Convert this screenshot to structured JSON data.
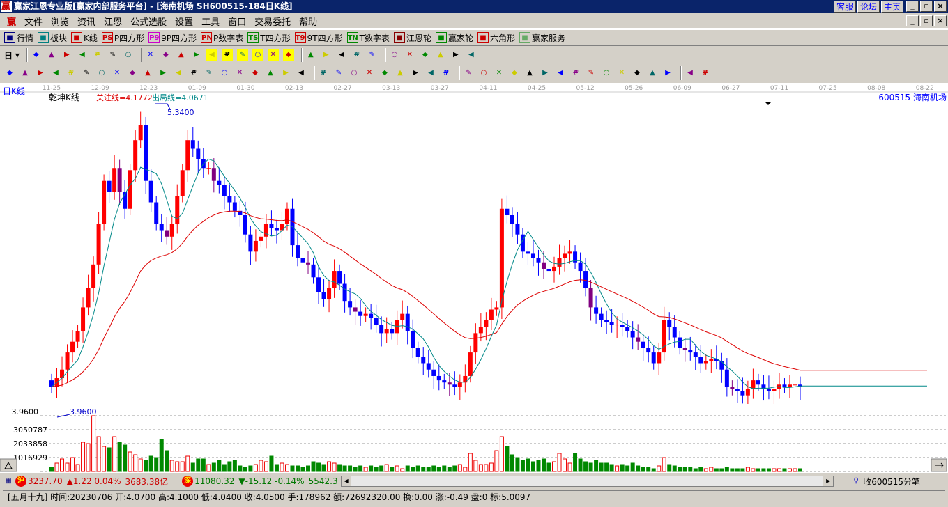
{
  "window": {
    "title": "赢家江恩专业版[赢家内部服务平台] - [海南机场   SH600515-184日K线]",
    "links": [
      "客服",
      "论坛",
      "主页"
    ],
    "controls": [
      "_",
      "▫",
      "×"
    ]
  },
  "menu": [
    "文件",
    "浏览",
    "资讯",
    "江恩",
    "公式选股",
    "设置",
    "工具",
    "窗口",
    "交易委托",
    "帮助"
  ],
  "toolbar1": [
    {
      "icon": "table-icon",
      "label": "行情"
    },
    {
      "icon": "blocks-icon",
      "label": "板块"
    },
    {
      "icon": "kline-icon",
      "label": "K线"
    },
    {
      "icon": "PS",
      "label": "P四方形"
    },
    {
      "icon": "P9",
      "label": "9P四方形"
    },
    {
      "icon": "PN",
      "label": "P数字表"
    },
    {
      "icon": "TS",
      "label": "T四方形"
    },
    {
      "icon": "T9",
      "label": "9T四方形"
    },
    {
      "icon": "TN",
      "label": "T数字表"
    },
    {
      "icon": "wheel-icon",
      "label": "江恩轮"
    },
    {
      "icon": "wheel-icon",
      "label": "赢家轮"
    },
    {
      "icon": "hexagon-icon",
      "label": "六角形"
    },
    {
      "icon": "dollar-icon",
      "label": "赢家服务"
    }
  ],
  "toolbar2": {
    "period": "日",
    "icons": [
      "zoom",
      "list",
      "k3",
      "k9",
      "candle",
      "cut",
      "flag",
      "first",
      "last",
      "left",
      "right",
      "d1",
      "d2",
      "d3",
      "d4",
      "d5",
      "d6",
      "hand",
      "cross",
      "line",
      "gate",
      "wave",
      "cal",
      "calc",
      "book",
      "save",
      "print",
      "monitor"
    ]
  },
  "toolbar3": {
    "icons": [
      "pen",
      "ii",
      "gold1",
      "gold2",
      "f",
      "spiral",
      "pen2",
      "circle",
      "iii",
      "n2",
      "angle",
      "target",
      "star",
      "box",
      "slash",
      "shen",
      "ying",
      "comb",
      "measure",
      "frame",
      "fan1",
      "fan2",
      "fan3",
      "angle2",
      "v",
      "grid1",
      "grid2",
      "lines",
      "bars",
      "pct1",
      "%",
      "pct2",
      "gold3",
      "gold4",
      "up",
      "ab",
      "gold5",
      "j",
      "f2",
      "gold6",
      "shen2",
      "ying2",
      "four",
      "yinyang",
      "infinity"
    ]
  },
  "chart": {
    "period_label": "日K线",
    "indicator": "乾坤K线",
    "focus_line": "关注线=4.1772",
    "exit_line": "出局线=4.0671",
    "stock": "600515 海南机场",
    "high_label": "5.3400",
    "low_label": "3.9600",
    "price_axis": "3.9600",
    "dates": [
      "11-25",
      "12-09",
      "12-23",
      "01-09",
      "01-30",
      "02-13",
      "02-27",
      "03-13",
      "03-27",
      "04-11",
      "04-25",
      "05-12",
      "05-26",
      "06-09",
      "06-27",
      "07-11",
      "07-25",
      "08-08",
      "08-22"
    ],
    "vol_ticks": [
      "3050787",
      "2033858",
      "1016929"
    ]
  },
  "chart_data": {
    "type": "candlestick",
    "price_range": [
      3.96,
      5.34
    ],
    "close": [
      4.04,
      4.08,
      4.12,
      4.2,
      4.25,
      4.3,
      4.41,
      4.5,
      4.61,
      4.8,
      5.0,
      4.95,
      5.06,
      4.95,
      4.87,
      5.05,
      5.19,
      5.26,
      5.0,
      4.9,
      4.8,
      4.77,
      4.74,
      4.8,
      4.93,
      5.05,
      5.19,
      5.15,
      5.1,
      5.06,
      5.06,
      5.0,
      4.98,
      4.93,
      4.9,
      4.86,
      4.84,
      4.75,
      4.67,
      4.72,
      4.74,
      4.8,
      4.78,
      4.77,
      4.8,
      4.87,
      4.7,
      4.64,
      4.62,
      4.61,
      4.55,
      4.48,
      4.45,
      4.5,
      4.58,
      4.52,
      4.44,
      4.41,
      4.39,
      4.37,
      4.38,
      4.36,
      4.33,
      4.29,
      4.31,
      4.29,
      4.35,
      4.38,
      4.3,
      4.22,
      4.18,
      4.15,
      4.12,
      4.09,
      4.07,
      4.06,
      4.05,
      4.04,
      4.06,
      4.09,
      4.2,
      4.29,
      4.32,
      4.35,
      4.4,
      4.41,
      4.87,
      4.84,
      4.8,
      4.75,
      4.67,
      4.66,
      4.64,
      4.62,
      4.59,
      4.58,
      4.6,
      4.64,
      4.66,
      4.67,
      4.62,
      4.58,
      4.5,
      4.41,
      4.38,
      4.35,
      4.34,
      4.33,
      4.33,
      4.32,
      4.3,
      4.27,
      4.25,
      4.22,
      4.2,
      4.15,
      4.2,
      4.35,
      4.32,
      4.27,
      4.22,
      4.21,
      4.2,
      4.18,
      4.15,
      4.16,
      4.17,
      4.16,
      4.12,
      4.04,
      4.03,
      4.02,
      4.0,
      4.03,
      4.07,
      4.05,
      4.03,
      4.02,
      4.03,
      4.05,
      4.04,
      4.05,
      4.05,
      4.04
    ],
    "volume_millions": [
      0.3,
      0.6,
      0.9,
      0.6,
      1.0,
      0.5,
      2.1,
      2.0,
      4.0,
      2.5,
      1.8,
      1.7,
      2.5,
      2.1,
      1.9,
      1.4,
      1.2,
      0.9,
      0.8,
      1.1,
      1.0,
      2.3,
      1.5,
      0.8,
      0.7,
      0.7,
      1.1,
      0.6,
      0.9,
      0.9,
      0.5,
      0.6,
      0.8,
      0.5,
      0.7,
      0.8,
      0.4,
      0.3,
      0.4,
      0.5,
      0.8,
      0.7,
      1.1,
      0.5,
      0.6,
      0.5,
      0.4,
      0.4,
      0.3,
      0.4,
      0.7,
      0.6,
      0.5,
      0.7,
      0.6,
      0.5,
      0.4,
      0.4,
      0.3,
      0.4,
      0.3,
      0.4,
      0.3,
      0.4,
      0.5,
      0.3,
      0.4,
      0.2,
      0.4,
      0.3,
      0.4,
      0.3,
      0.3,
      0.4,
      0.3,
      0.4,
      0.3,
      0.4,
      0.5,
      0.3,
      1.3,
      0.8,
      0.5,
      0.5,
      0.6,
      1.5,
      2.5,
      1.8,
      1.2,
      1.0,
      0.8,
      0.9,
      0.7,
      0.8,
      0.9,
      0.6,
      0.7,
      1.3,
      0.9,
      0.6,
      1.3,
      0.9,
      0.7,
      0.6,
      0.8,
      0.6,
      0.6,
      0.5,
      0.4,
      0.5,
      0.4,
      0.6,
      0.4,
      0.3,
      0.3,
      0.2,
      0.4,
      1.0,
      0.5,
      0.4,
      0.3,
      0.3,
      0.3,
      0.2,
      0.3,
      0.2,
      0.3,
      0.2,
      0.2,
      0.3,
      0.2,
      0.2,
      0.2,
      0.3,
      0.2,
      0.2,
      0.2,
      0.2,
      0.2,
      0.2,
      0.2,
      0.2,
      0.2,
      0.2
    ]
  },
  "status": {
    "sh_badge": "沪",
    "sh": "3237.70",
    "sh_chg": "▲1.22 0.04%",
    "sh_amt": "3683.38亿",
    "sz_badge": "深",
    "sz": "11080.32",
    "sz_chg": "▼-15.12 -0.14%",
    "sz_amt": "5542.3",
    "tick": "收600515分笔"
  },
  "info": "[五月十九] 时间:20230706 开:4.0700 高:4.1000 低:4.0400 收:4.0500 手:178962 额:72692320.00 换:0.00 涨:-0.49 盘:0 标:5.0097"
}
